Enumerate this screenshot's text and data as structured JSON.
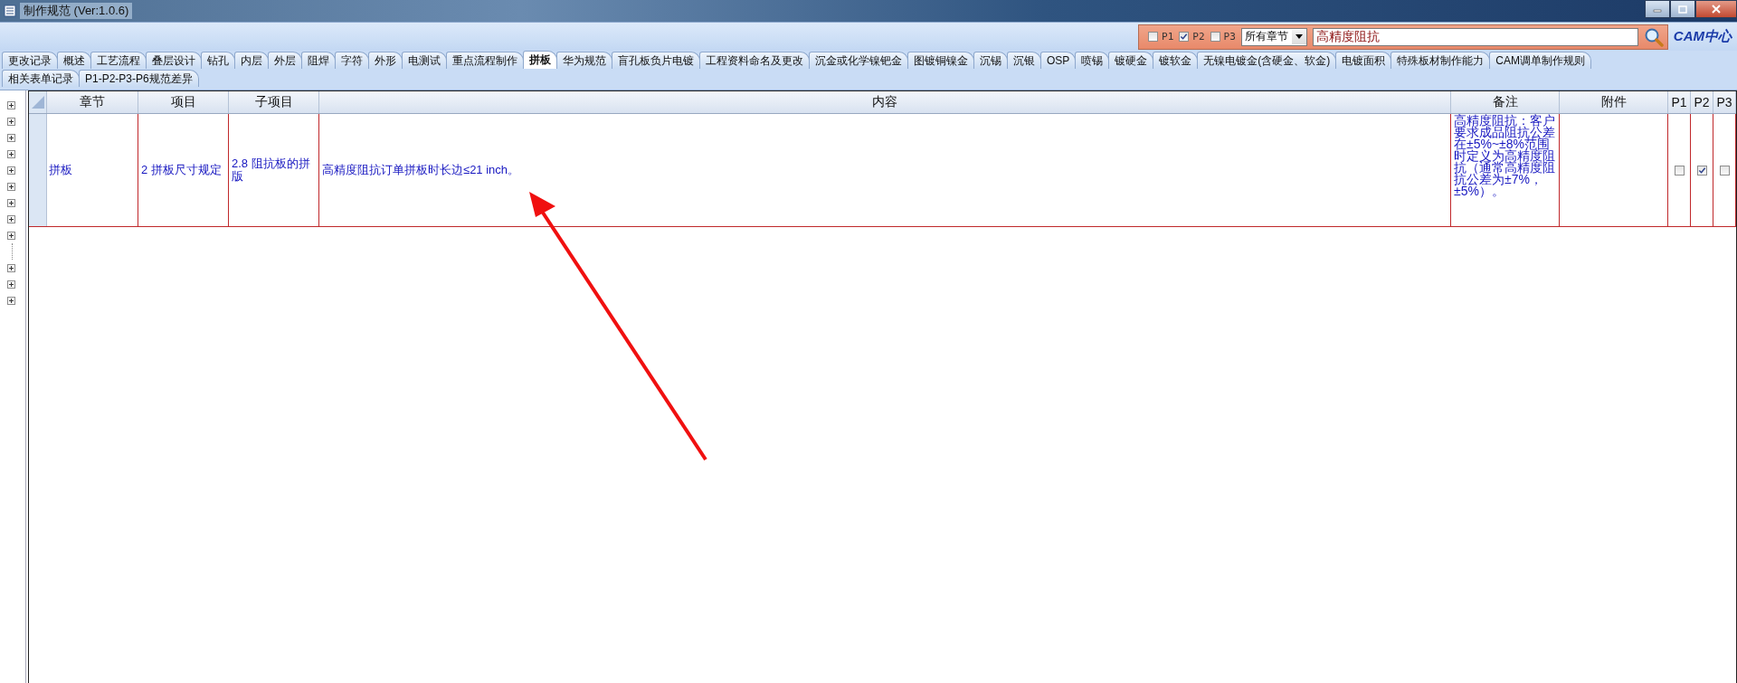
{
  "window": {
    "title": "制作规范 (Ver:1.0.6)"
  },
  "filter": {
    "options": [
      {
        "label": "P1",
        "checked": false
      },
      {
        "label": "P2",
        "checked": true
      },
      {
        "label": "P3",
        "checked": false
      }
    ],
    "chapter": "所有章节",
    "search": "高精度阻抗"
  },
  "logo": "CAM中心",
  "tab_rows": [
    [
      {
        "label": "更改记录",
        "selected": false
      },
      {
        "label": "概述",
        "selected": false
      },
      {
        "label": "工艺流程",
        "selected": false
      },
      {
        "label": "叠层设计",
        "selected": false
      },
      {
        "label": "钻孔",
        "selected": false
      },
      {
        "label": "内层",
        "selected": false
      },
      {
        "label": "外层",
        "selected": false
      },
      {
        "label": "阻焊",
        "selected": false
      },
      {
        "label": "字符",
        "selected": false
      },
      {
        "label": "外形",
        "selected": false
      },
      {
        "label": "电测试",
        "selected": false
      },
      {
        "label": "重点流程制作",
        "selected": false
      },
      {
        "label": "拼板",
        "selected": true
      },
      {
        "label": "华为规范",
        "selected": false
      },
      {
        "label": "盲孔板负片电镀",
        "selected": false
      },
      {
        "label": "工程资料命名及更改",
        "selected": false
      },
      {
        "label": "沉金或化学镍钯金",
        "selected": false
      },
      {
        "label": "图镀铜镍金",
        "selected": false
      },
      {
        "label": "沉锡",
        "selected": false
      },
      {
        "label": "沉银",
        "selected": false
      },
      {
        "label": "OSP",
        "selected": false
      },
      {
        "label": "喷锡",
        "selected": false
      },
      {
        "label": "镀硬金",
        "selected": false
      },
      {
        "label": "镀软金",
        "selected": false
      },
      {
        "label": "无镍电镀金(含硬金、软金)",
        "selected": false
      },
      {
        "label": "电镀面积",
        "selected": false
      },
      {
        "label": "特殊板材制作能力",
        "selected": false
      },
      {
        "label": "CAM调单制作规则",
        "selected": false
      }
    ],
    [
      {
        "label": "相关表单记录",
        "selected": false
      },
      {
        "label": "P1-P2-P3-P6规范差异",
        "selected": false
      }
    ]
  ],
  "tree": [
    {
      "kind": "node",
      "expanded": false
    },
    {
      "kind": "node",
      "expanded": false
    },
    {
      "kind": "node",
      "expanded": false
    },
    {
      "kind": "node",
      "expanded": false
    },
    {
      "kind": "node",
      "expanded": false
    },
    {
      "kind": "node",
      "expanded": false
    },
    {
      "kind": "node",
      "expanded": false
    },
    {
      "kind": "node",
      "expanded": false
    },
    {
      "kind": "node",
      "expanded": false
    },
    {
      "kind": "spacer"
    },
    {
      "kind": "node",
      "expanded": false
    },
    {
      "kind": "node",
      "expanded": false
    },
    {
      "kind": "node",
      "expanded": false
    }
  ],
  "table": {
    "columns": [
      "章节",
      "项目",
      "子项目",
      "内容",
      "备注",
      "附件",
      "P1",
      "P2",
      "P3"
    ],
    "rows": [
      {
        "cells": [
          "拼板",
          "2 拼板尺寸规定",
          "2.8 阻抗板的拼版",
          "高精度阻抗订单拼板时长边≤21 inch。",
          "高精度阻抗：客户要求成品阻抗公差在±5%~±8%范围时定义为高精度阻抗（通常高精度阻抗公差为±7%，±5%）。"
        ],
        "flags": [
          {
            "checked": false
          },
          {
            "checked": true
          },
          {
            "checked": false
          }
        ]
      }
    ]
  }
}
